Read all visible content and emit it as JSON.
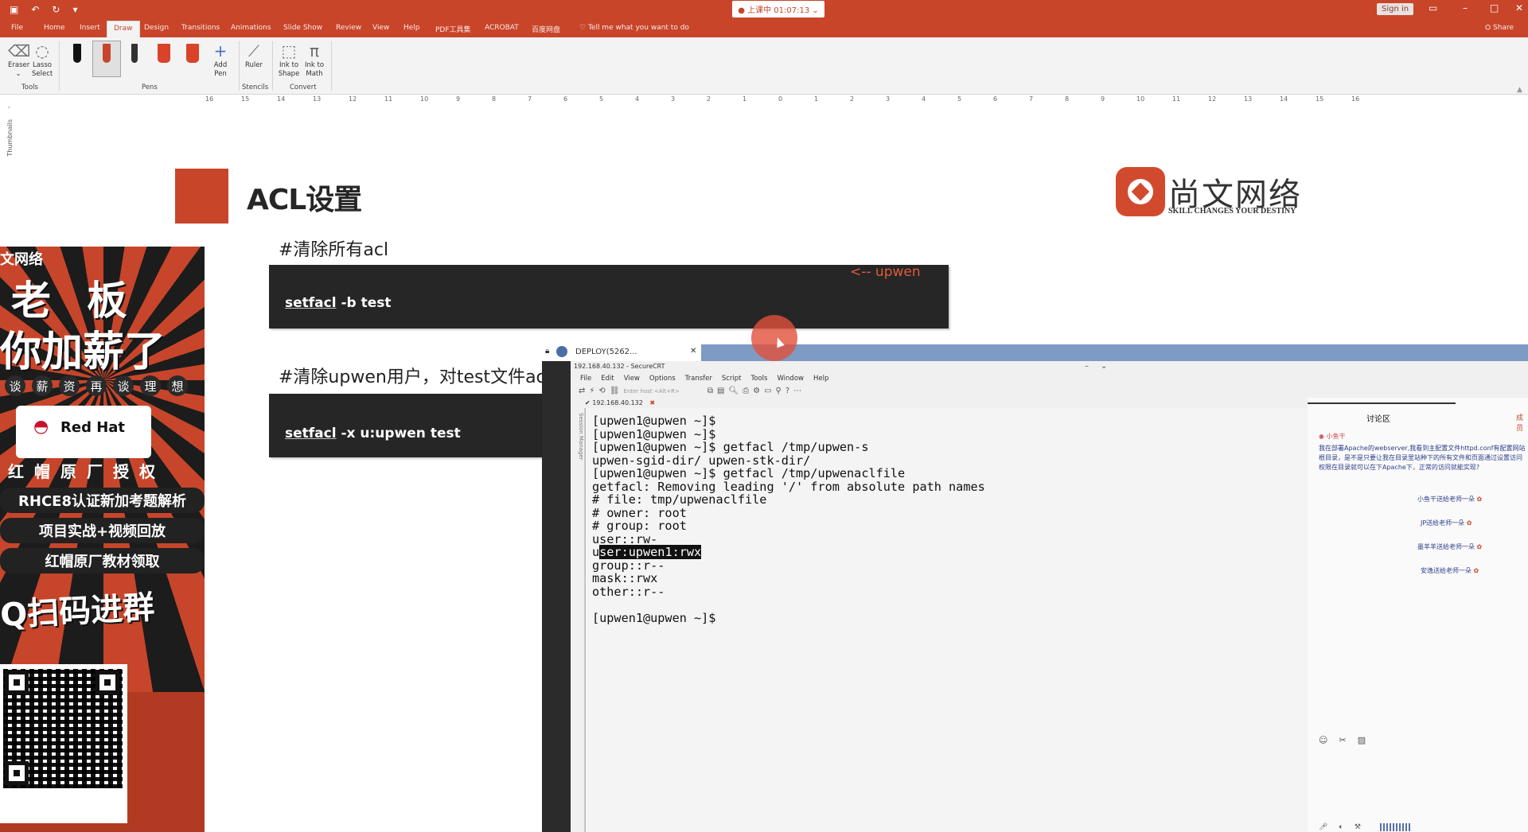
{
  "titlebar": {
    "recording": "● 上课中 01:07:13 ⌄",
    "sign_in": "Sign in",
    "share": "⛭ Share"
  },
  "tabs": [
    "File",
    "Home",
    "Insert",
    "Draw",
    "Design",
    "Transitions",
    "Animations",
    "Slide Show",
    "Review",
    "View",
    "Help",
    "PDF工具集",
    "ACROBAT",
    "百度网盘"
  ],
  "tell_me": "Tell me what you want to do",
  "ribbon": {
    "eraser": "Eraser",
    "lasso": "Lasso Select",
    "tools_group": "Tools",
    "pens_group": "Pens",
    "add_pen": "Add Pen",
    "ruler": "Ruler",
    "stencils_group": "Stencils",
    "ink_to_shape": "Ink to Shape",
    "ink_to_math": "Ink to Math",
    "convert_group": "Convert"
  },
  "ruler_ticks": [
    "16",
    "15",
    "14",
    "13",
    "12",
    "11",
    "10",
    "9",
    "8",
    "7",
    "6",
    "5",
    "4",
    "3",
    "2",
    "1",
    "0",
    "1",
    "2",
    "3",
    "4",
    "5",
    "6",
    "7",
    "8",
    "9",
    "10",
    "11",
    "12",
    "13",
    "14",
    "15",
    "16"
  ],
  "thumbnails_label": "Thumbnails",
  "slide": {
    "title": "ACL设置",
    "logo_name": "尚文网络",
    "logo_sub": "SKILL CHANGES YOUR DESTINY",
    "comment1": "#清除所有acl",
    "code1_cmd": "setfacl",
    "code1_args": " -b test",
    "upwen_tag": "<-- upwen",
    "comment2": "#清除upwen用户，对test文件acl",
    "code2_cmd": "setfacl",
    "code2_args": " -x u:upwen test"
  },
  "ad": {
    "brand": "文网络",
    "line1": "老 板",
    "line2": "你加薪了",
    "chars": [
      "谈",
      "薪",
      "资",
      "再",
      "谈",
      "理",
      "想"
    ],
    "redhat": "Red Hat",
    "slogan_chars": [
      "红",
      "帽",
      "原",
      "厂",
      "授",
      "权"
    ],
    "pill1": "RHCE8认证新加考题解析",
    "pill2": "项目实战+视频回放",
    "pill3": "红帽原厂教材领取",
    "qq": "Q扫码进群"
  },
  "crt": {
    "tab_label": "DEPLOY(5262...",
    "window_title": "192.168.40.132 - SecureCRT",
    "menu": [
      "File",
      "Edit",
      "View",
      "Options",
      "Transfer",
      "Script",
      "Tools",
      "Window",
      "Help"
    ],
    "host_hint": "Enter host <Alt+R>",
    "session_tab": "✔ 192.168.40.132",
    "session_manager": "Session Manager",
    "terminal_lines": [
      "[upwen1@upwen ~]$",
      "[upwen1@upwen ~]$",
      "[upwen1@upwen ~]$ getfacl /tmp/upwen-s",
      "upwen-sgid-dir/ upwen-stk-dir/",
      "[upwen1@upwen ~]$ getfacl /tmp/upwenaclfile",
      "getfacl: Removing leading '/' from absolute path names",
      "# file: tmp/upwenaclfile",
      "# owner: root",
      "# group: root",
      "user::rw-",
      "user:upwen1:rwx",
      "group::r--",
      "mask::rwx",
      "other::r--",
      "",
      "[upwen1@upwen ~]$"
    ],
    "highlight_line_index": 10,
    "highlight_prefix": "u",
    "highlight_text": "ser:upwen1:rwx"
  },
  "discussion": {
    "title": "讨论区",
    "more": "成员",
    "user": "小鱼干",
    "message": "我在部署Apache的webserver,我看到主配置文件httpd.conf有配置网站根目录，是不是只要让我在目录里站种下的所有文件和页面通过设置访问权限在目录就可以在下Apache下，正常的访问就能实现?",
    "gifts": [
      "小鱼干送给老师一朵",
      "JP送给老师一朵",
      "墨羊羊送给老师一朵",
      "安逸送给老师一朵"
    ]
  },
  "colors": {
    "accent": "#c8452a",
    "dark": "#262626",
    "crt_tab": "#7d9bc4"
  }
}
